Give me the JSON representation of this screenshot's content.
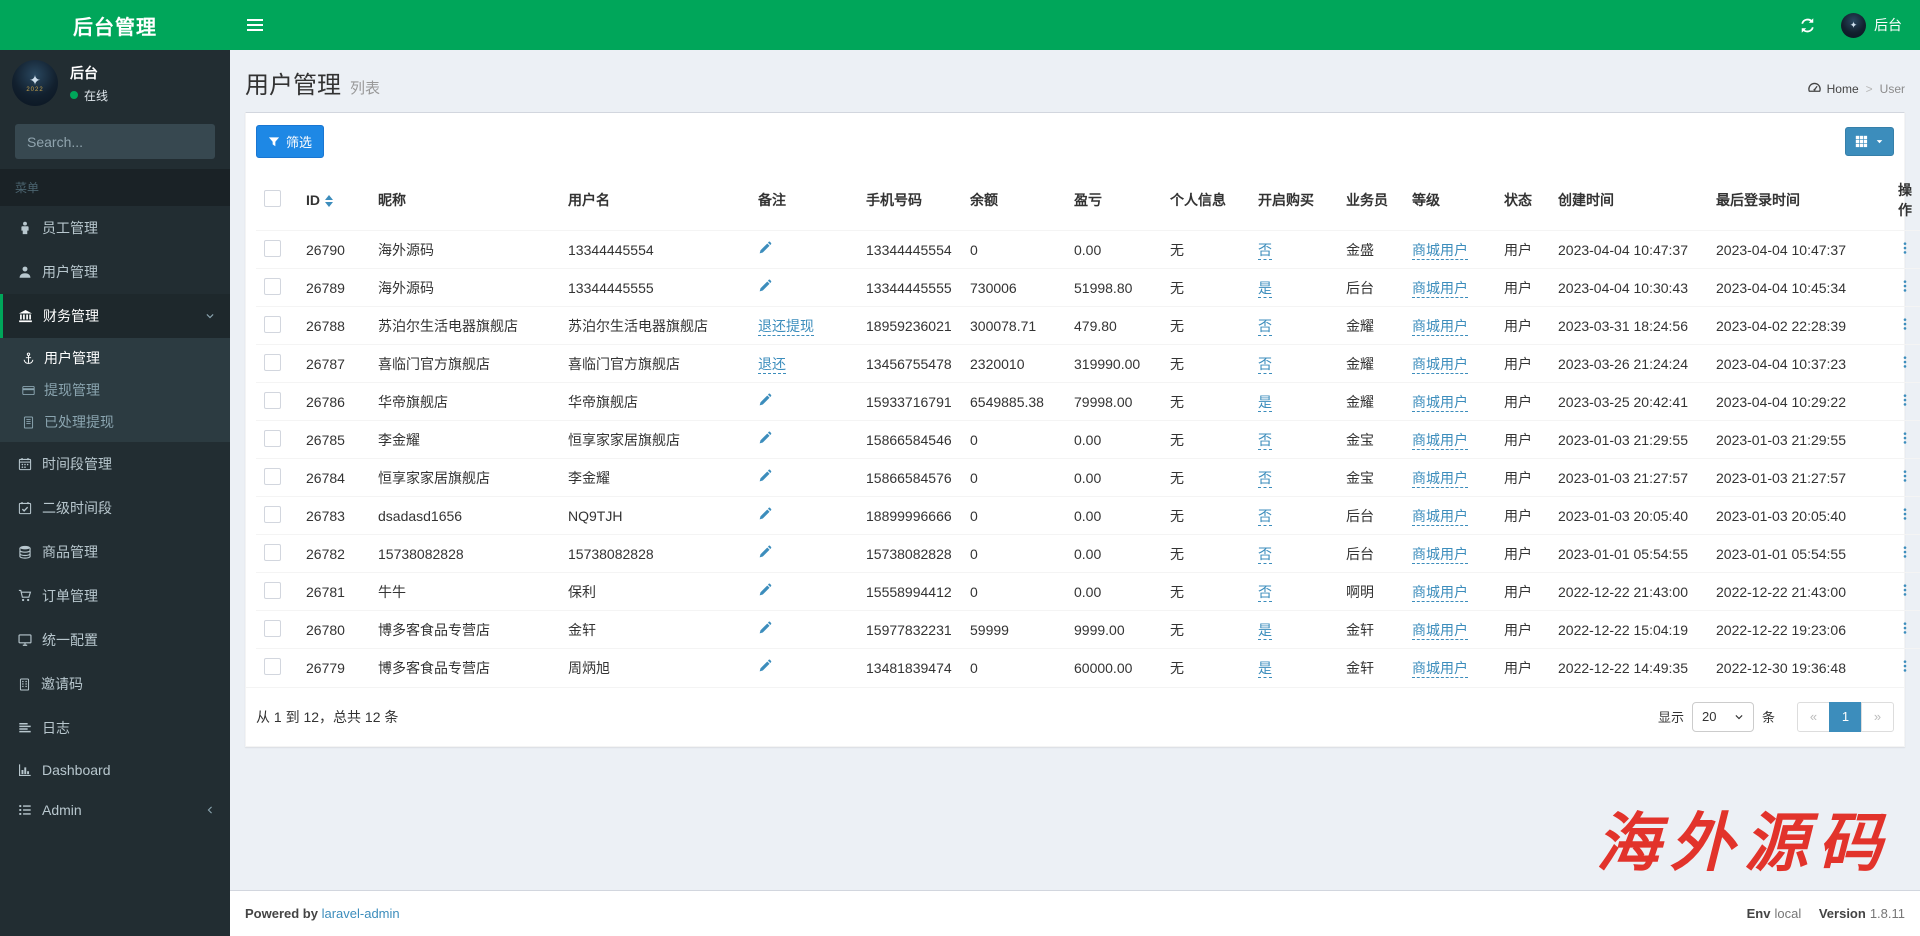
{
  "app": {
    "logo": "后台管理"
  },
  "navbar": {
    "user_label": "后台"
  },
  "sidebar": {
    "user": {
      "name": "后台",
      "status": "在线",
      "avatar_year": "2022"
    },
    "search_placeholder": "Search...",
    "menu_header": "菜单",
    "items": [
      {
        "label": "员工管理",
        "icon": "staff-icon"
      },
      {
        "label": "用户管理",
        "icon": "user-icon"
      },
      {
        "label": "财务管理",
        "icon": "bank-icon",
        "active": true,
        "expanded": true,
        "children": [
          {
            "label": "用户管理",
            "icon": "anchor-icon",
            "active": true
          },
          {
            "label": "提现管理",
            "icon": "credit-card-icon"
          },
          {
            "label": "已处理提现",
            "icon": "journal-icon"
          }
        ]
      },
      {
        "label": "时间段管理",
        "icon": "calendar-icon"
      },
      {
        "label": "二级时间段",
        "icon": "calendar-check-icon"
      },
      {
        "label": "商品管理",
        "icon": "database-icon"
      },
      {
        "label": "订单管理",
        "icon": "cart-icon"
      },
      {
        "label": "统一配置",
        "icon": "desktop-icon"
      },
      {
        "label": "邀请码",
        "icon": "book-icon"
      },
      {
        "label": "日志",
        "icon": "log-lines-icon"
      },
      {
        "label": "Dashboard",
        "icon": "bar-chart-icon"
      },
      {
        "label": "Admin",
        "icon": "list-icon",
        "collapsible": true
      }
    ]
  },
  "header": {
    "title": "用户管理",
    "subtitle": "列表"
  },
  "breadcrumb": {
    "home": "Home",
    "current": "User"
  },
  "toolbar": {
    "filter_label": "筛选"
  },
  "table": {
    "columns": [
      {
        "key": "id",
        "label": "ID",
        "sortable": true
      },
      {
        "key": "nickname",
        "label": "昵称"
      },
      {
        "key": "username",
        "label": "用户名"
      },
      {
        "key": "remark",
        "label": "备注"
      },
      {
        "key": "phone",
        "label": "手机号码"
      },
      {
        "key": "balance",
        "label": "余额"
      },
      {
        "key": "profit",
        "label": "盈亏"
      },
      {
        "key": "personal_info",
        "label": "个人信息"
      },
      {
        "key": "buy_enabled",
        "label": "开启购买"
      },
      {
        "key": "salesman",
        "label": "业务员"
      },
      {
        "key": "level",
        "label": "等级"
      },
      {
        "key": "status",
        "label": "状态"
      },
      {
        "key": "created_at",
        "label": "创建时间"
      },
      {
        "key": "last_login_at",
        "label": "最后登录时间"
      },
      {
        "key": "actions",
        "label": "操作"
      }
    ],
    "rows": [
      {
        "id": "26790",
        "nickname": "海外源码",
        "username": "13344445554",
        "remark": {
          "kind": "pencil"
        },
        "phone": "13344445554",
        "balance": "0",
        "profit": "0.00",
        "personal_info": "无",
        "buy_enabled": "否",
        "salesman": "金盛",
        "level": "商城用户",
        "status": "用户",
        "created_at": "2023-04-04 10:47:37",
        "last_login_at": "2023-04-04 10:47:37"
      },
      {
        "id": "26789",
        "nickname": "海外源码",
        "username": "13344445555",
        "remark": {
          "kind": "pencil"
        },
        "phone": "13344445555",
        "balance": "730006",
        "profit": "51998.80",
        "personal_info": "无",
        "buy_enabled": "是",
        "salesman": "后台",
        "level": "商城用户",
        "status": "用户",
        "created_at": "2023-04-04 10:30:43",
        "last_login_at": "2023-04-04 10:45:34"
      },
      {
        "id": "26788",
        "nickname": "苏泊尔生活电器旗舰店",
        "username": "苏泊尔生活电器旗舰店",
        "remark": {
          "kind": "link",
          "text": "退还提现"
        },
        "phone": "18959236021",
        "balance": "300078.71",
        "profit": "479.80",
        "personal_info": "无",
        "buy_enabled": "否",
        "salesman": "金耀",
        "level": "商城用户",
        "status": "用户",
        "created_at": "2023-03-31 18:24:56",
        "last_login_at": "2023-04-02 22:28:39"
      },
      {
        "id": "26787",
        "nickname": "喜临门官方旗舰店",
        "username": "喜临门官方旗舰店",
        "remark": {
          "kind": "link",
          "text": "退还"
        },
        "phone": "13456755478",
        "balance": "2320010",
        "profit": "319990.00",
        "personal_info": "无",
        "buy_enabled": "否",
        "salesman": "金耀",
        "level": "商城用户",
        "status": "用户",
        "created_at": "2023-03-26 21:24:24",
        "last_login_at": "2023-04-04 10:37:23"
      },
      {
        "id": "26786",
        "nickname": "华帝旗舰店",
        "username": "华帝旗舰店",
        "remark": {
          "kind": "pencil"
        },
        "phone": "15933716791",
        "balance": "6549885.38",
        "profit": "79998.00",
        "personal_info": "无",
        "buy_enabled": "是",
        "salesman": "金耀",
        "level": "商城用户",
        "status": "用户",
        "created_at": "2023-03-25 20:42:41",
        "last_login_at": "2023-04-04 10:29:22"
      },
      {
        "id": "26785",
        "nickname": "李金耀",
        "username": "恒享家家居旗舰店",
        "remark": {
          "kind": "pencil"
        },
        "phone": "15866584546",
        "balance": "0",
        "profit": "0.00",
        "personal_info": "无",
        "buy_enabled": "否",
        "salesman": "金宝",
        "level": "商城用户",
        "status": "用户",
        "created_at": "2023-01-03 21:29:55",
        "last_login_at": "2023-01-03 21:29:55"
      },
      {
        "id": "26784",
        "nickname": "恒享家家居旗舰店",
        "username": "李金耀",
        "remark": {
          "kind": "pencil"
        },
        "phone": "15866584576",
        "balance": "0",
        "profit": "0.00",
        "personal_info": "无",
        "buy_enabled": "否",
        "salesman": "金宝",
        "level": "商城用户",
        "status": "用户",
        "created_at": "2023-01-03 21:27:57",
        "last_login_at": "2023-01-03 21:27:57"
      },
      {
        "id": "26783",
        "nickname": "dsadasd1656",
        "username": "NQ9TJH",
        "remark": {
          "kind": "pencil"
        },
        "phone": "18899996666",
        "balance": "0",
        "profit": "0.00",
        "personal_info": "无",
        "buy_enabled": "否",
        "salesman": "后台",
        "level": "商城用户",
        "status": "用户",
        "created_at": "2023-01-03 20:05:40",
        "last_login_at": "2023-01-03 20:05:40"
      },
      {
        "id": "26782",
        "nickname": "15738082828",
        "username": "15738082828",
        "remark": {
          "kind": "pencil"
        },
        "phone": "15738082828",
        "balance": "0",
        "profit": "0.00",
        "personal_info": "无",
        "buy_enabled": "否",
        "salesman": "后台",
        "level": "商城用户",
        "status": "用户",
        "created_at": "2023-01-01 05:54:55",
        "last_login_at": "2023-01-01 05:54:55"
      },
      {
        "id": "26781",
        "nickname": "牛牛",
        "username": "保利",
        "remark": {
          "kind": "pencil"
        },
        "phone": "15558994412",
        "balance": "0",
        "profit": "0.00",
        "personal_info": "无",
        "buy_enabled": "否",
        "salesman": "啊明",
        "level": "商城用户",
        "status": "用户",
        "created_at": "2022-12-22 21:43:00",
        "last_login_at": "2022-12-22 21:43:00"
      },
      {
        "id": "26780",
        "nickname": "博多客食品专营店",
        "username": "金轩",
        "remark": {
          "kind": "pencil"
        },
        "phone": "15977832231",
        "balance": "59999",
        "profit": "9999.00",
        "personal_info": "无",
        "buy_enabled": "是",
        "salesman": "金轩",
        "level": "商城用户",
        "status": "用户",
        "created_at": "2022-12-22 15:04:19",
        "last_login_at": "2022-12-22 19:23:06"
      },
      {
        "id": "26779",
        "nickname": "博多客食品专营店",
        "username": "周炳旭",
        "remark": {
          "kind": "pencil"
        },
        "phone": "13481839474",
        "balance": "0",
        "profit": "60000.00",
        "personal_info": "无",
        "buy_enabled": "是",
        "salesman": "金轩",
        "level": "商城用户",
        "status": "用户",
        "created_at": "2022-12-22 14:49:35",
        "last_login_at": "2022-12-30 19:36:48"
      }
    ]
  },
  "pagination": {
    "summary": "从 1 到 12，总共 12 条",
    "show_label": "显示",
    "per_page": "20",
    "unit_label": "条",
    "pages": [
      {
        "label": "«",
        "state": "disabled"
      },
      {
        "label": "1",
        "state": "active"
      },
      {
        "label": "»",
        "state": "disabled"
      }
    ]
  },
  "footer": {
    "powered_prefix": "Powered by",
    "powered_link": "laravel-admin",
    "env_label": "Env",
    "env_value": "local",
    "version_label": "Version",
    "version_value": "1.8.11"
  },
  "watermark": {
    "text": "海外源码"
  },
  "colors": {
    "brand_green": "#00a65a",
    "sidebar_bg": "#222d32",
    "link_blue": "#3c8dbc",
    "filter_blue": "#1e88e5",
    "watermark_red": "#e2231a"
  }
}
